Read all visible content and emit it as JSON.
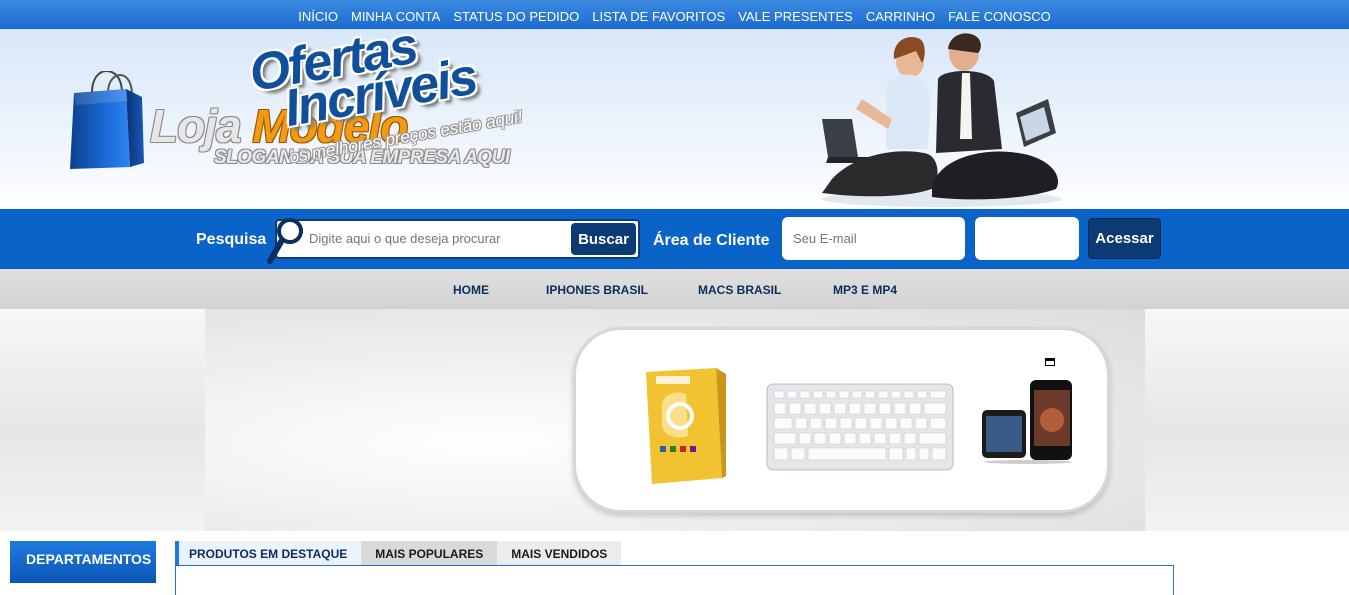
{
  "top_nav": {
    "items": [
      "INÍCIO",
      "MINHA CONTA",
      "STATUS DO PEDIDO",
      "LISTA DE FAVORITOS",
      "VALE PRESENTES",
      "CARRINHO",
      "FALE CONOSCO"
    ]
  },
  "header": {
    "logo_word1": "Loja",
    "logo_word2": "Modelo",
    "slogan": "SLOGAN DA SUA EMPRESA AQUI"
  },
  "search": {
    "label": "Pesquisa",
    "placeholder": "Digite aqui o que deseja procurar",
    "button": "Buscar"
  },
  "client_area": {
    "label": "Área de Cliente",
    "email_placeholder": "Seu E-mail",
    "password_value": "",
    "button": "Acessar"
  },
  "category_nav": {
    "items": [
      "HOME",
      "IPHONES BRASIL",
      "MACS BRASIL",
      "MP3 E MP4"
    ]
  },
  "banner": {
    "headline_1": "Ofertas",
    "headline_2": "Incríveis",
    "tagline": "os melhores preços estão aqui!",
    "products": [
      "office-box-image",
      "keyboard-image",
      "iphone-ipod-image"
    ]
  },
  "sidebar": {
    "title": "DEPARTAMENTOS"
  },
  "product_tabs": {
    "items": [
      "PRODUTOS EM DESTAQUE",
      "MAIS POPULARES",
      "MAIS VENDIDOS"
    ],
    "active": "PRODUTOS EM DESTAQUE"
  },
  "colors": {
    "primary_blue": "#0a63c9",
    "dark_blue": "#0b3a75",
    "logo_orange": "#f39a12"
  }
}
